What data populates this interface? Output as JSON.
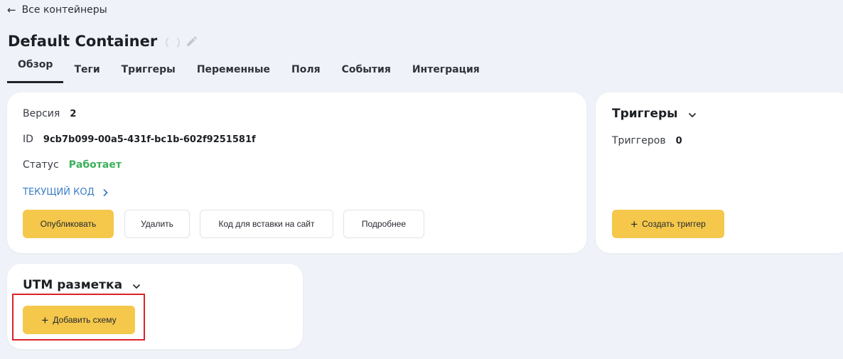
{
  "nav": {
    "back_label": "Все контейнеры"
  },
  "header": {
    "title": "Default Container"
  },
  "tabs": [
    {
      "label": "Обзор",
      "active": true
    },
    {
      "label": "Теги"
    },
    {
      "label": "Триггеры"
    },
    {
      "label": "Переменные"
    },
    {
      "label": "Поля"
    },
    {
      "label": "События"
    },
    {
      "label": "Интеграция"
    }
  ],
  "container": {
    "version_label": "Версия",
    "version_value": "2",
    "id_label": "ID",
    "id_value": "9cb7b099-00a5-431f-bc1b-602f9251581f",
    "status_label": "Статус",
    "status_value": "Работает",
    "current_code_link": "ТЕКУЩИЙ КОД",
    "buttons": {
      "publish": "Опубликовать",
      "delete": "Удалить",
      "embed_code": "Код для вставки на сайт",
      "details": "Подробнее"
    }
  },
  "triggers_card": {
    "title": "Триггеры",
    "count_label": "Триггеров",
    "count_value": "0",
    "create_button": "Создать триггер"
  },
  "utm_card": {
    "title": "UTM разметка",
    "add_button": "Добавить схему"
  },
  "colors": {
    "background": "#eff2f8",
    "accent_yellow": "#f5c84b",
    "status_green": "#3ab05a",
    "link_blue": "#3a7ec5",
    "highlight_red": "#d9242a"
  }
}
